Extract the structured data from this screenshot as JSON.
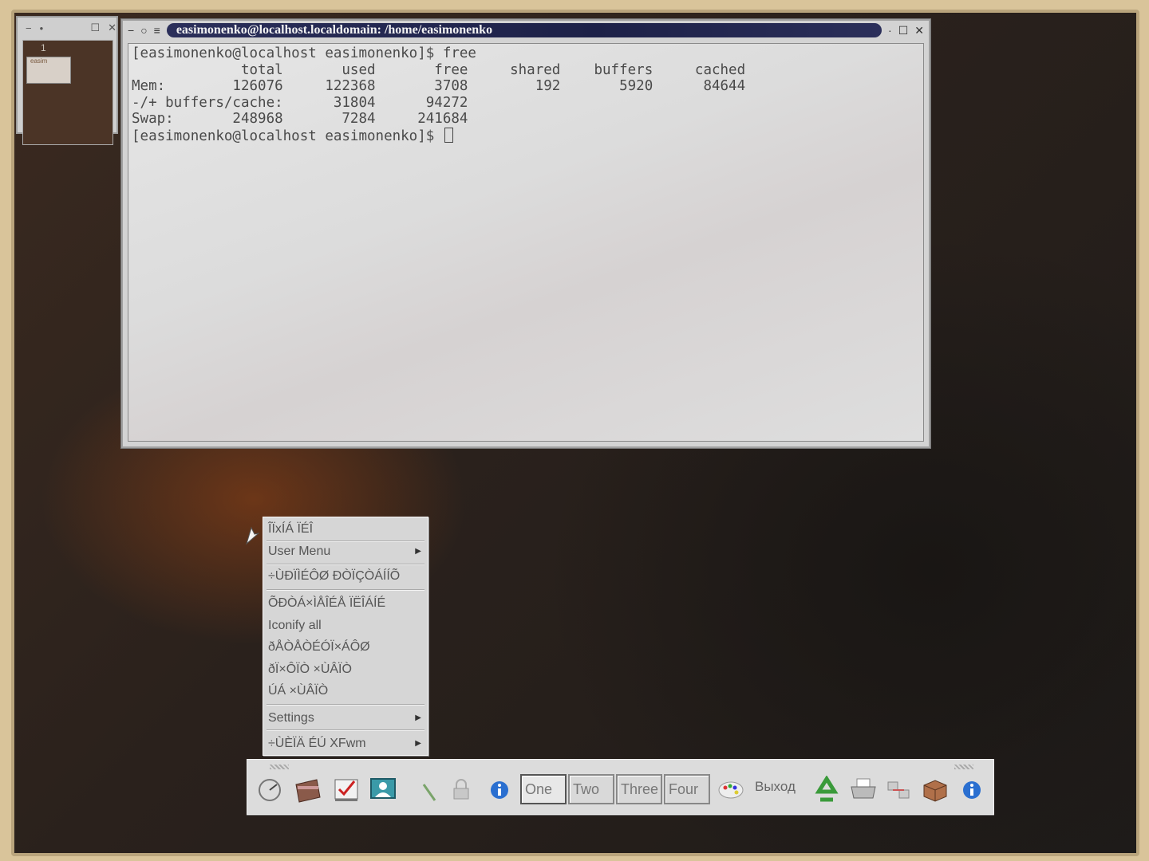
{
  "pager": {
    "desktop_number": "1",
    "mini_window_label": "easim"
  },
  "terminal": {
    "title": "easimonenko@localhost.localdomain: /home/easimonenko",
    "lines": [
      "[easimonenko@localhost easimonenko]$ free",
      "             total       used       free     shared    buffers     cached",
      "Mem:        126076     122368       3708        192       5920      84644",
      "-/+ buffers/cache:      31804      94272",
      "Swap:       248968       7284     241684",
      "[easimonenko@localhost easimonenko]$ "
    ]
  },
  "menu": {
    "items": [
      {
        "label": "ÎÏxÍÁ ÏÉÎ",
        "submenu": false
      },
      {
        "label": "User Menu",
        "submenu": true
      },
      {
        "label": "÷ÙÐÏÌÉÔØ ÐÒÏÇÒÁÍÍÕ",
        "submenu": false
      },
      {
        "label": "ÕÐÒÁ×ÌÅÎÉÅ ÏËÎÁÍÉ",
        "submenu": false
      },
      {
        "label": "Iconify all",
        "submenu": false
      },
      {
        "label": "ðÅÒÅÒÉÓÏ×ÁÔØ",
        "submenu": false
      },
      {
        "label": "ðÏ×ÔÏÒ ×ÙÂÏÒ",
        "submenu": false
      },
      {
        "label": "ÚÁ ×ÙÂÏÒ",
        "submenu": false
      },
      {
        "label": "Settings",
        "submenu": true
      },
      {
        "label": "÷ÙÈÏÄ ÉÚ XFwm",
        "submenu": true
      }
    ]
  },
  "panel": {
    "desktops": [
      "One",
      "Two",
      "Three",
      "Four"
    ],
    "active_desktop": "One",
    "logout_label": "Выход",
    "icons_left": [
      "clock-icon",
      "folder-icon",
      "checklist-icon",
      "monitor-icon",
      "pen-icon",
      "lock-icon",
      "info-icon"
    ],
    "icons_right": [
      "palette-icon",
      "recycle-icon",
      "printer-icon",
      "network-icon",
      "package-icon",
      "info-icon"
    ]
  }
}
